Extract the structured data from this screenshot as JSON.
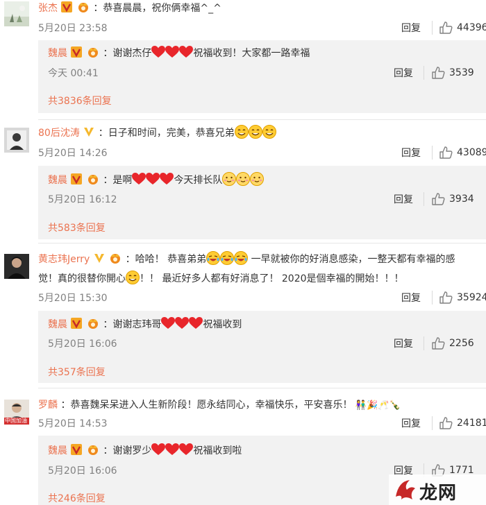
{
  "comments": [
    {
      "user": "张杰",
      "text": "：恭喜晨晨，祝你俩幸福^_^",
      "time": "5月20日 23:58",
      "reply": "回复",
      "likes": "44396",
      "sub": {
        "user": "魏晨",
        "text_a": "：谢谢杰仔",
        "text_b": "祝福收到！大家都一路幸福",
        "time": "今天 00:41",
        "reply": "回复",
        "likes": "3539"
      },
      "more": "共3836条回复"
    },
    {
      "user": "80后沈涛",
      "text": "：日子和时间，完美，恭喜兄弟",
      "time": "5月20日 14:26",
      "reply": "回复",
      "likes": "43089",
      "sub": {
        "user": "魏晨",
        "text_a": "：是啊",
        "text_b": "今天排长队",
        "time": "5月20日 16:12",
        "reply": "回复",
        "likes": "3934"
      },
      "more": "共583条回复"
    },
    {
      "user": "黄志玮Jerry",
      "text_a": "：哈哈！ 恭喜弟弟",
      "text_b": "一早就被你的好消息感染，一整天都有幸福的感",
      "text_c": "觉！真的很替你開心",
      "text_d": "！！ 最近好多人都有好消息了！ 2020是個幸福的開始！！！",
      "time": "5月20日 15:30",
      "reply": "回复",
      "likes": "35924",
      "sub": {
        "user": "魏晨",
        "text_a": "：谢谢志玮哥",
        "text_b": "祝福收到",
        "time": "5月20日 16:06",
        "reply": "回复",
        "likes": "2256"
      },
      "more": "共357条回复"
    },
    {
      "user": "罗麟",
      "text": "：恭喜魏呆呆进入人生新阶段！愿永结同心，幸福快乐，平安喜乐！",
      "time": "5月20日 14:53",
      "reply": "回复",
      "likes": "24181",
      "avatar_caption": "中国加油",
      "sub": {
        "user": "魏晨",
        "text_a": "：谢谢罗少",
        "text_b": "祝福收到啦",
        "time": "5月20日 16:06",
        "reply": "回复",
        "likes": "1771"
      },
      "more": "共246条回复"
    }
  ],
  "watermark": "龙网",
  "colors": {
    "username": "#eb7350",
    "meta": "#808080",
    "reply_bg": "#f2f2f2",
    "heart": "#e8262b",
    "vip": "#f5a623"
  }
}
